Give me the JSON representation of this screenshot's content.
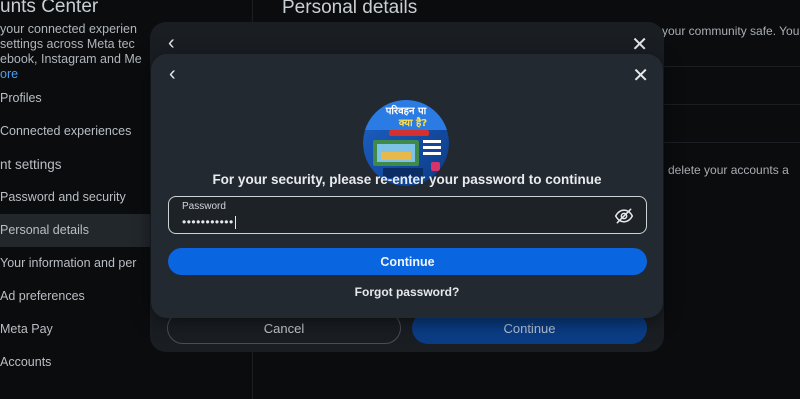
{
  "background": {
    "title": "unts Center",
    "description": "your connected experie... settings across Meta tec... ebook, Instagram and Me...",
    "description_lines": [
      "your connected experien",
      "settings across Meta tec",
      "ebook, Instagram and Me"
    ],
    "more_link": "ore",
    "nav": [
      {
        "label": "Profiles"
      },
      {
        "label": "Connected experiences"
      },
      {
        "label": "nt settings"
      },
      {
        "label": "Password and security"
      },
      {
        "label": "Personal details"
      },
      {
        "label": "Your information and per"
      },
      {
        "label": "Ad preferences"
      },
      {
        "label": "Meta Pay"
      },
      {
        "label": "Accounts"
      }
    ],
    "right_title": "Personal details",
    "right_text_1": "your community safe. You",
    "right_text_2": "delete your accounts a"
  },
  "outer_modal": {
    "back_glyph": "‹",
    "close_glyph": "✕",
    "cancel_label": "Cancel",
    "continue_label": "Continue"
  },
  "dialog": {
    "back_glyph": "‹",
    "close_glyph": "✕",
    "avatar_text_1": "परिवहन पा",
    "avatar_text_2": "क्या है?",
    "prompt": "For your security, please re-enter your password to continue",
    "password_label": "Password",
    "password_value": "•••••••••••",
    "continue_label": "Continue",
    "forgot_label": "Forgot password?"
  },
  "colors": {
    "primary": "#0a66e0",
    "dialog_bg": "#232930",
    "page_bg": "#0a0c0e"
  }
}
